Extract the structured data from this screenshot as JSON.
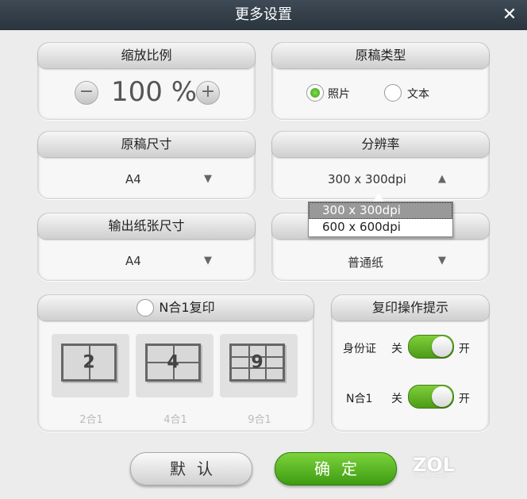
{
  "window": {
    "title": "更多设置",
    "close_glyph": "✕"
  },
  "zoom": {
    "header": "缩放比例",
    "minus": "−",
    "value": "100 %",
    "plus": "+"
  },
  "original_type": {
    "header": "原稿类型",
    "options": [
      "照片",
      "文本"
    ],
    "selected": "照片"
  },
  "original_size": {
    "header": "原稿尺寸",
    "value": "A4",
    "arrow": "▼"
  },
  "resolution": {
    "header": "分辨率",
    "value": "300 x 300dpi",
    "arrow": "▲",
    "options": [
      "300 x 300dpi",
      "600 x 600dpi"
    ],
    "selected": "300 x 300dpi"
  },
  "output_size": {
    "header": "输出纸张尺寸",
    "value": "A4",
    "arrow": "▼"
  },
  "paper_type": {
    "header": "",
    "value": "普通纸",
    "arrow": "▼"
  },
  "n_in_1": {
    "header": "N合1复印",
    "tiles": [
      {
        "number": "2",
        "caption": "2合1"
      },
      {
        "number": "4",
        "caption": "4合1"
      },
      {
        "number": "9",
        "caption": "9合1"
      }
    ]
  },
  "copy_hints": {
    "header": "复印操作提示",
    "rows": [
      {
        "label": "身份证",
        "off": "关",
        "on": "开",
        "state": "on"
      },
      {
        "label": "N合1",
        "off": "关",
        "on": "开",
        "state": "on"
      }
    ]
  },
  "buttons": {
    "default": "默认",
    "ok": "确定"
  },
  "watermark": {
    "brand": "ZOL",
    "sub": "中关村在线"
  },
  "colors": {
    "accent_green": "#4c9b18",
    "titlebar": "#2a343d"
  }
}
